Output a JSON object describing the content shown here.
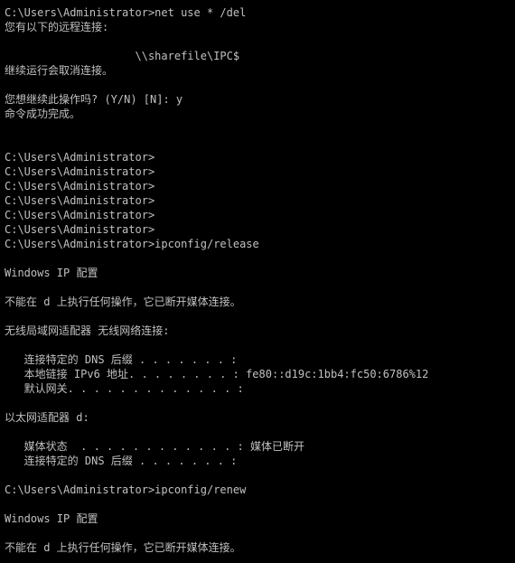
{
  "console": {
    "colors": {
      "background": "#000000",
      "foreground": "#c0c0c0"
    },
    "lines": [
      "C:\\Users\\Administrator>net use * /del",
      "您有以下的远程连接:",
      "",
      "                    \\\\sharefile\\IPC$",
      "继续运行会取消连接。",
      "",
      "您想继续此操作吗? (Y/N) [N]: y",
      "命令成功完成。",
      "",
      "",
      "C:\\Users\\Administrator>",
      "C:\\Users\\Administrator>",
      "C:\\Users\\Administrator>",
      "C:\\Users\\Administrator>",
      "C:\\Users\\Administrator>",
      "C:\\Users\\Administrator>",
      "C:\\Users\\Administrator>ipconfig/release",
      "",
      "Windows IP 配置",
      "",
      "不能在 d 上执行任何操作，它已断开媒体连接。",
      "",
      "无线局域网适配器 无线网络连接:",
      "",
      "   连接特定的 DNS 后缀 . . . . . . . :",
      "   本地链接 IPv6 地址. . . . . . . . : fe80::d19c:1bb4:fc50:6786%12",
      "   默认网关. . . . . . . . . . . . . :",
      "",
      "以太网适配器 d:",
      "",
      "   媒体状态  . . . . . . . . . . . . : 媒体已断开",
      "   连接特定的 DNS 后缀 . . . . . . . :",
      "",
      "C:\\Users\\Administrator>ipconfig/renew",
      "",
      "Windows IP 配置",
      "",
      "不能在 d 上执行任何操作，它已断开媒体连接。"
    ]
  }
}
